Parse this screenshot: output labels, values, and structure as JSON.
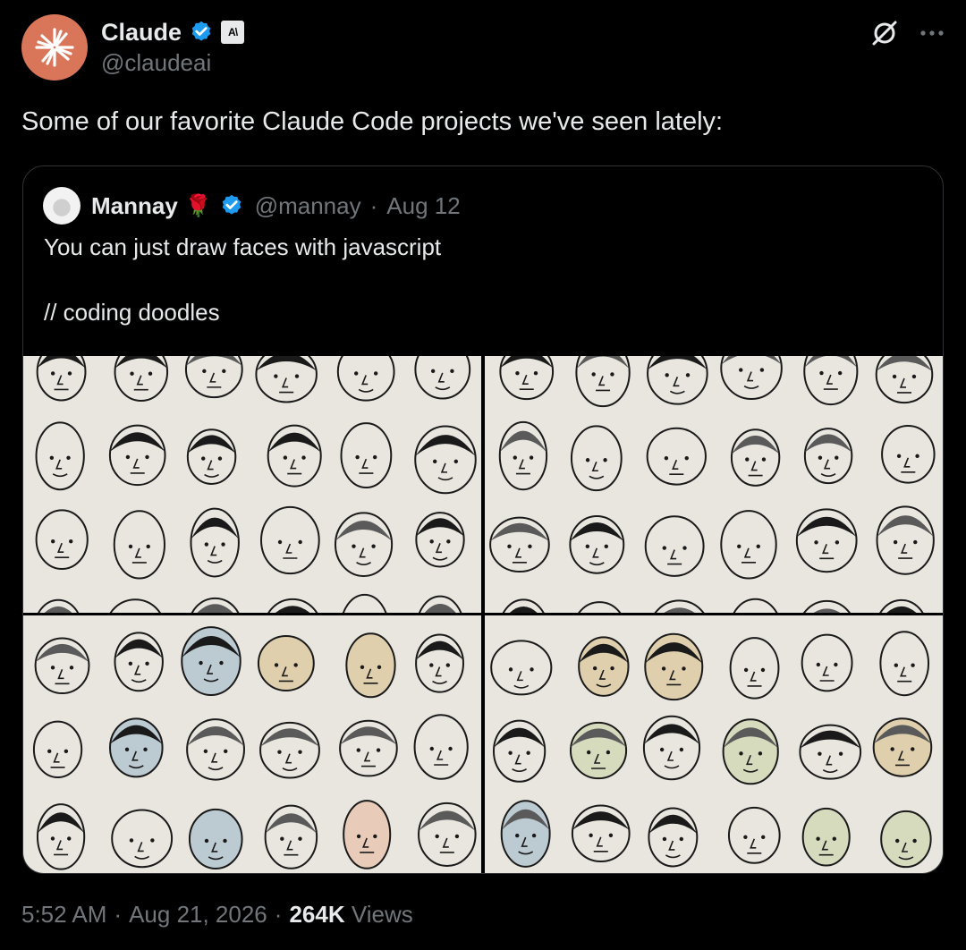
{
  "author": {
    "name": "Claude",
    "handle": "@claudeai",
    "avatar_icon": "claude-sunburst-icon",
    "avatar_color": "#d9765a",
    "verified_color": "#1d9bf0"
  },
  "post": {
    "text": "Some of our favorite Claude Code projects we've seen lately:",
    "time": "5:52 AM",
    "date": "Aug 21, 2026",
    "views_count": "264K",
    "views_label": "Views",
    "separator": "·"
  },
  "quoted": {
    "name": "Mannay",
    "emoji": "🌹",
    "handle": "@mannay",
    "date": "Aug 12",
    "separator": "·",
    "line1": "You can just draw faces with javascript",
    "line2": "// coding doodles"
  },
  "media": {
    "panel_count": 4,
    "paper_color": "#e9e6df",
    "content": "hand-drawn doodle faces grid"
  },
  "icons": [
    "grok-icon",
    "more-icon",
    "verified-badge-icon",
    "anthropic-affiliate-icon"
  ]
}
